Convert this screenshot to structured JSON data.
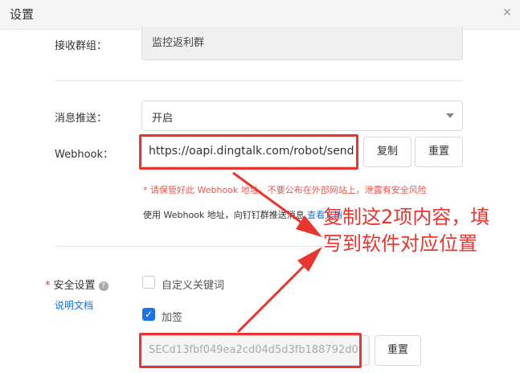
{
  "window": {
    "title": "设置",
    "close_glyph": "✕"
  },
  "receive_group": {
    "label": "接收群组：",
    "value": "监控返利群"
  },
  "push": {
    "label": "消息推送：",
    "value": "开启"
  },
  "webhook": {
    "label": "Webhook：",
    "value": "https://oapi.dingtalk.com/robot/send",
    "copy_label": "复制",
    "reset_label": "重置",
    "warning": "* 请保管好此 Webhook 地址，不要公布在外部网站上，泄露有安全风险",
    "usage_prefix": "使用 Webhook 地址，向钉钉群推送消息",
    "usage_link": "查看文档"
  },
  "security": {
    "label": "安全设置",
    "required_mark": "*",
    "help_glyph": "?",
    "doc_link": "说明文档",
    "opt_keyword": "自定义关键词",
    "opt_sign": "加签",
    "sign_checked": true,
    "secret_value": "SECd13fbf049ea2cd04d5d3fb188792d0",
    "reset_label": "重置"
  },
  "annotation": {
    "line1": "复制这2项内容，填",
    "line2": "写到软件对应位置",
    "color": "#e8352e"
  }
}
